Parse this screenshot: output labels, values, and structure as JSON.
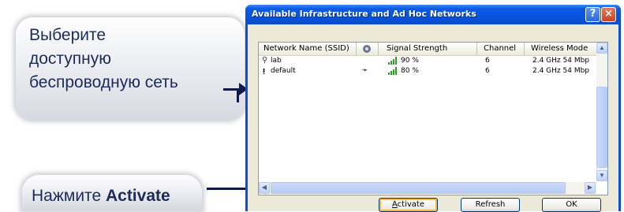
{
  "callouts": {
    "select": [
      "Выберите",
      "доступную",
      "беспроводную сеть"
    ],
    "activate_prefix": "Нажмите ",
    "activate_bold": "Activate"
  },
  "window": {
    "title": "Available Infrastructure and Ad Hoc Networks",
    "help_label": "?",
    "close_label": "×"
  },
  "columns": {
    "name": "Network Name (SSID)",
    "signal": "Signal Strength",
    "channel": "Channel",
    "mode": "Wireless Mode"
  },
  "networks": [
    {
      "icon": "access-point-icon",
      "name": "lab",
      "security_icon": "",
      "signal": "90 %",
      "signal_level": 0.9,
      "channel": "6",
      "mode": "2.4 GHz 54 Mbp"
    },
    {
      "icon": "adhoc-station-icon",
      "name": "default",
      "security_icon": "key-icon",
      "signal": "80 %",
      "signal_level": 0.8,
      "channel": "6",
      "mode": "2.4 GHz 54 Mbp"
    }
  ],
  "buttons": {
    "activate": "Activate",
    "refresh": "Refresh",
    "ok": "OK"
  },
  "colors": {
    "title_blue": "#0a4fd6",
    "signal_green": "#2e9c20",
    "callout_text": "#1b2b5a"
  }
}
